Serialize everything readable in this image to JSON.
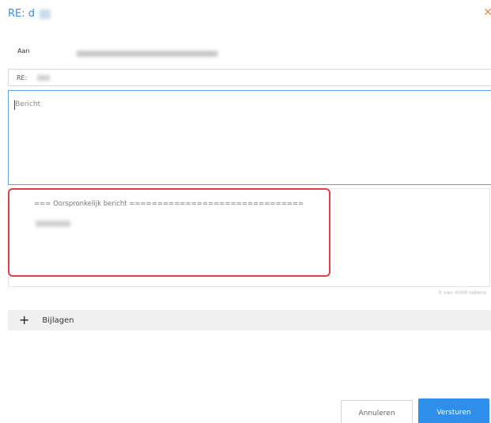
{
  "dialog": {
    "title": "RE: d",
    "close_icon": "close-icon"
  },
  "to": {
    "label": "Aan"
  },
  "subject": {
    "value": "RE:"
  },
  "message": {
    "placeholder": "Bericht"
  },
  "quoted": {
    "header": "=== Oorspronkelijk bericht ==============================="
  },
  "counter": {
    "text": "0 van 4000 tekens"
  },
  "attachments": {
    "label": "Bijlagen",
    "icon": "plus-icon"
  },
  "buttons": {
    "cancel": "Annuleren",
    "send": "Versturen"
  },
  "colors": {
    "accent": "#2f8ee9",
    "highlight": "#e0404a",
    "close": "#f08a3c"
  }
}
